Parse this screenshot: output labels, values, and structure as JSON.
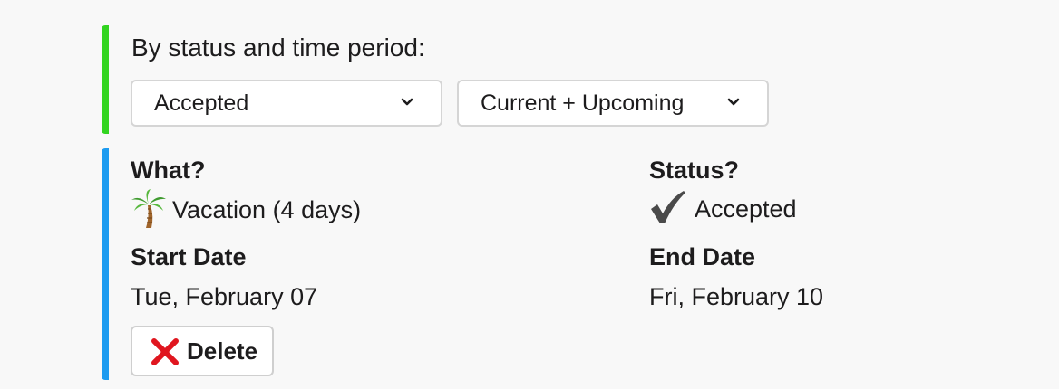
{
  "filters": {
    "label": "By status and time period:",
    "status_select": {
      "value": "Accepted"
    },
    "period_select": {
      "value": "Current + Upcoming"
    }
  },
  "entry": {
    "what_label": "What?",
    "what_value": "Vacation (4 days)",
    "what_icon": "palm-tree-icon",
    "status_label": "Status?",
    "status_value": "Accepted",
    "status_icon": "check-mark-icon",
    "start_label": "Start Date",
    "start_value": "Tue, February 07",
    "end_label": "End Date",
    "end_value": "Fri, February 10",
    "delete_label": "Delete",
    "delete_icon": "cross-mark-icon"
  },
  "colors": {
    "filter_accent": "#32d420",
    "entry_accent": "#1d9bf0",
    "delete_icon": "#e0161f",
    "check": "#4a4a4a"
  }
}
